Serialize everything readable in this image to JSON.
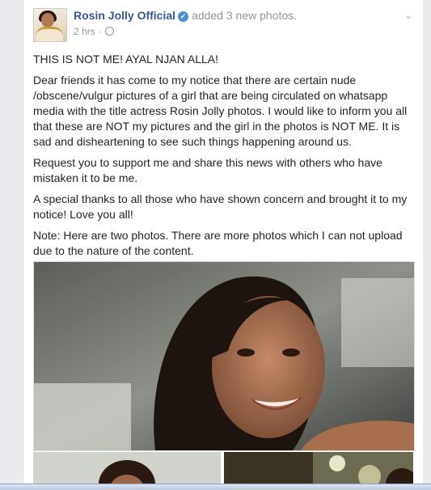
{
  "post": {
    "author": "Rosin Jolly Official",
    "verified_icon": "verified-badge-icon",
    "action": "added 3 new photos.",
    "time": "2 hrs",
    "privacy_icon": "globe-icon",
    "menu_icon": "chevron-down-icon",
    "paragraphs": [
      "THIS IS NOT ME! AYAL NJAN ALLA!",
      "Dear friends it has come to my notice that there are certain nude /obscene/vulgur pictures of a girl that are being circulated on whatsapp media with the title actress Rosin Jolly photos. I would like to inform you all that these are NOT my pictures and the girl in the photos is NOT ME. It is sad and disheartening to see such things happening around us.",
      "Request you to support me and share this news with others who have mistaken it to be me.",
      "A special thanks to all those who have shown concern and brought it to my notice! Love you all!",
      "Note: Here are two photos. There are more photos which I can not upload due to the nature of the content."
    ],
    "photo_count": 3
  }
}
